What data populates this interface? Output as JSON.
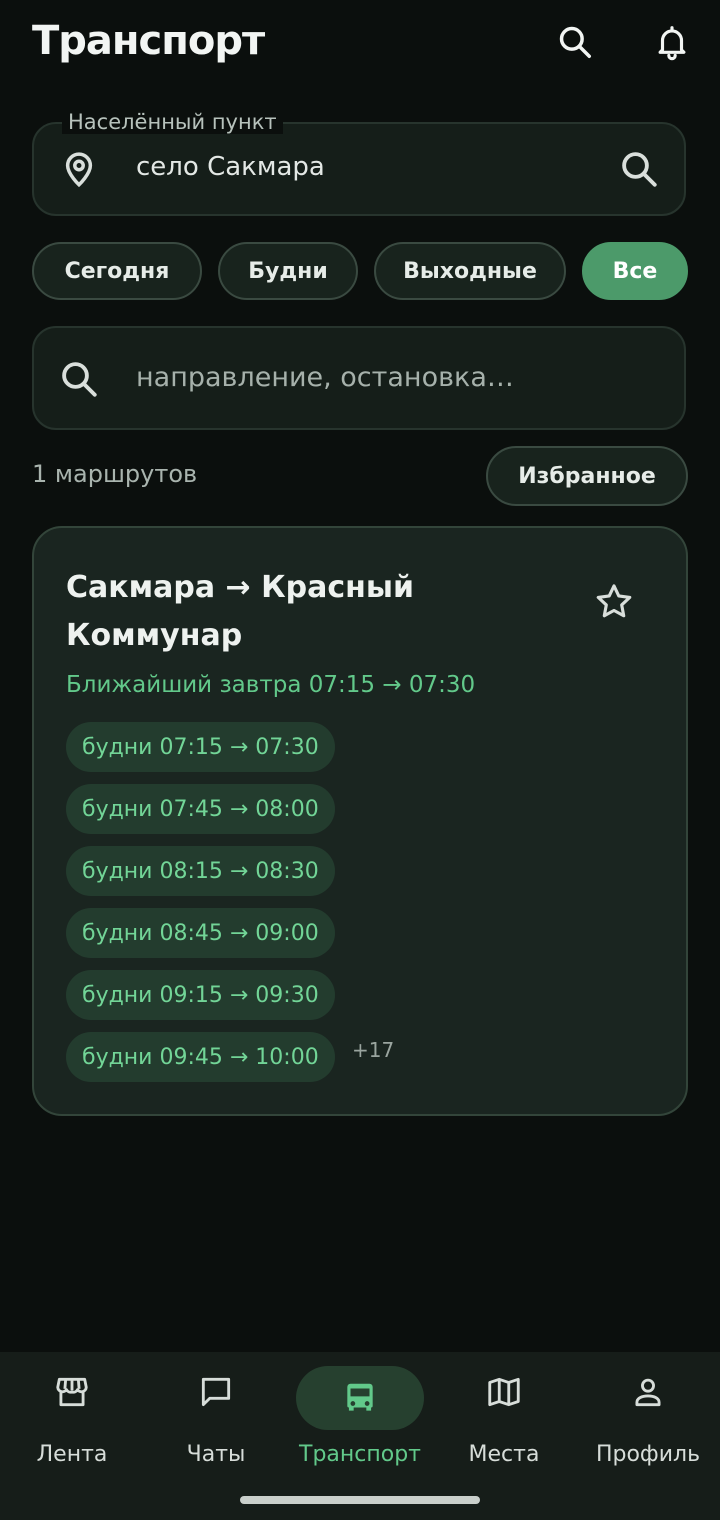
{
  "header": {
    "title": "Транспорт",
    "search_icon": "search-icon",
    "bell_icon": "bell-icon"
  },
  "locality": {
    "label": "Населённый пункт",
    "value": "село Сакмара",
    "pin_icon": "map-pin-icon",
    "search_icon": "search-icon"
  },
  "filters": [
    {
      "label": "Сегодня",
      "active": false
    },
    {
      "label": "Будни",
      "active": false
    },
    {
      "label": "Выходные",
      "active": false
    },
    {
      "label": "Все",
      "active": true
    }
  ],
  "search": {
    "placeholder": "направление, остановка…",
    "icon": "search-icon"
  },
  "routes": {
    "count_text": "1 маршрутов",
    "favorites_label": "Избранное"
  },
  "route_card": {
    "title": "Сакмара → Красный Коммунар",
    "nearest": "Ближайший завтра 07:15 → 07:30",
    "star_icon": "star-outline-icon",
    "trips": [
      "будни 07:15 → 07:30",
      "будни 07:45 → 08:00",
      "будни 08:15 → 08:30",
      "будни 08:45 → 09:00",
      "будни 09:15 → 09:30",
      "будни 09:45 → 10:00"
    ],
    "more": "+17"
  },
  "bottom_nav": [
    {
      "label": "Лента",
      "icon": "storefront-icon",
      "active": false
    },
    {
      "label": "Чаты",
      "icon": "chat-icon",
      "active": false
    },
    {
      "label": "Транспорт",
      "icon": "bus-icon",
      "active": true
    },
    {
      "label": "Места",
      "icon": "map-icon",
      "active": false
    },
    {
      "label": "Профиль",
      "icon": "person-icon",
      "active": false
    }
  ],
  "colors": {
    "background": "#0b0f0d",
    "accent": "#4c9a6a",
    "accent_text": "#62c98a",
    "card": "#1a2520"
  }
}
